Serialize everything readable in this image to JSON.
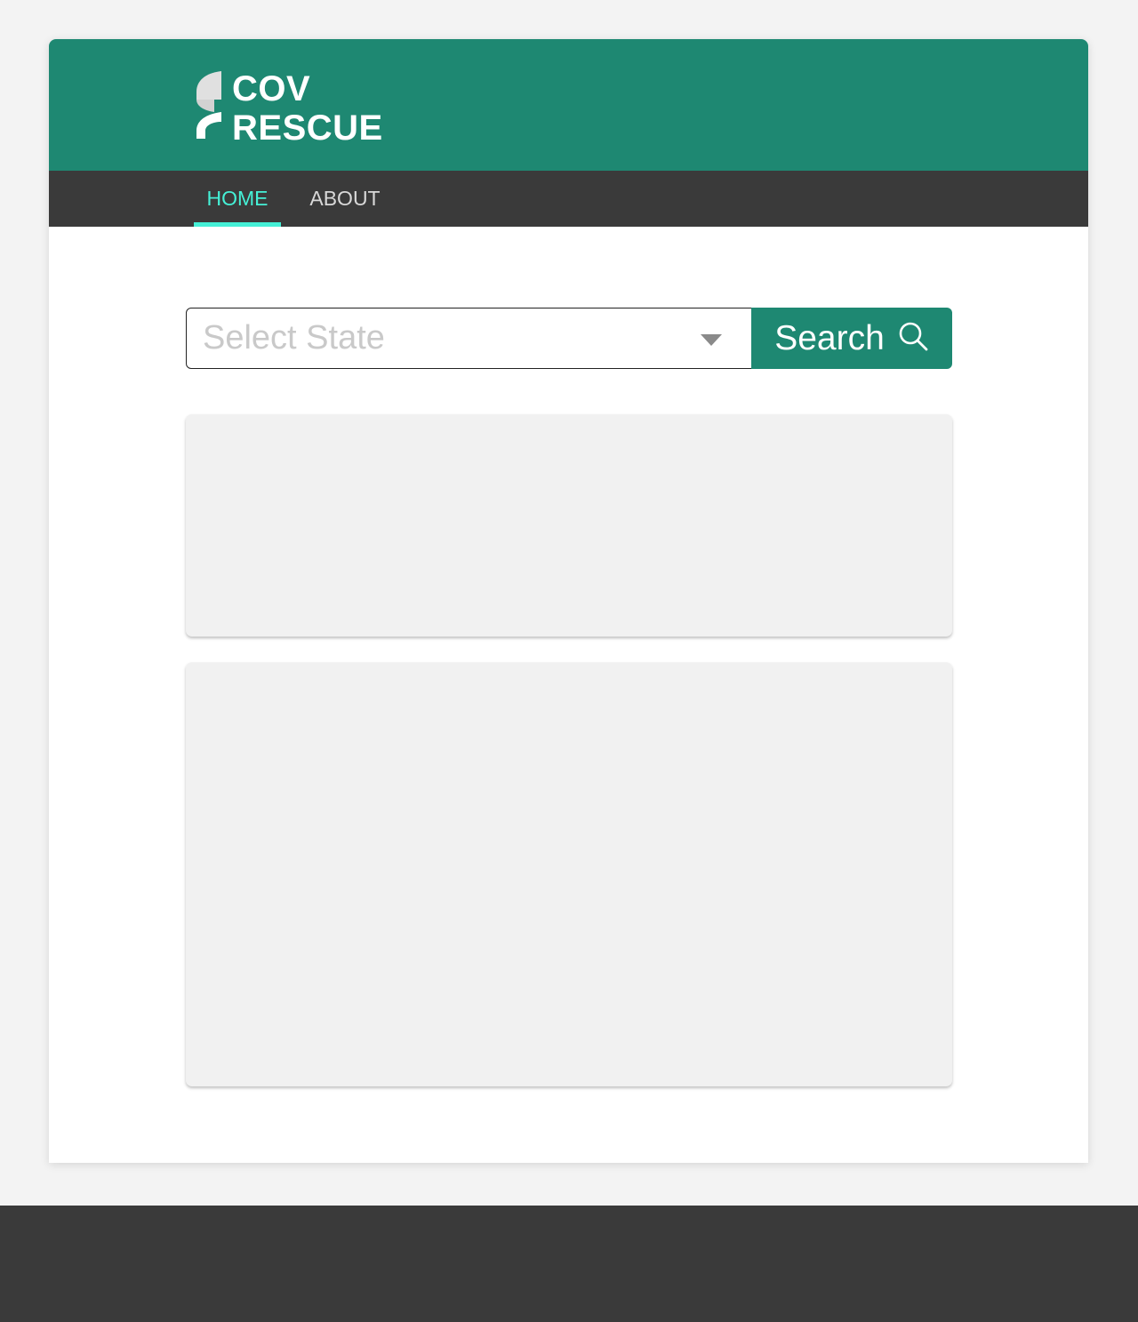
{
  "brand": {
    "line1": "COV",
    "line2": "RESCUE",
    "logo_icon": "cov-rescue-logo-mark",
    "header_color": "#1e8872"
  },
  "nav": {
    "tabs": [
      {
        "label": "HOME",
        "active": true
      },
      {
        "label": "ABOUT",
        "active": false
      }
    ],
    "active_color": "#45f0d6",
    "background": "#3a3a3a"
  },
  "search": {
    "select_placeholder": "Select State",
    "button_label": "Search",
    "button_icon": "search-icon",
    "dropdown_icon": "caret-down-icon"
  }
}
